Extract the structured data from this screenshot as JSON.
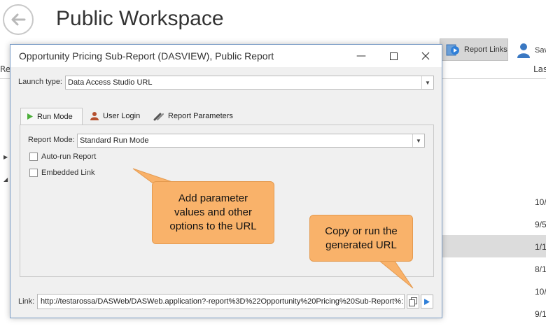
{
  "workspace": {
    "title": "Public Workspace",
    "toolbar": {
      "report_links_label": "Report Links",
      "save_label": "Sav"
    },
    "grid_header": {
      "left": "Re",
      "right": "Las"
    },
    "row_dates": [
      "10/",
      "9/5",
      "1/1",
      "8/1",
      "10/",
      "9/1"
    ]
  },
  "dialog": {
    "title": "Opportunity Pricing Sub-Report (DASVIEW), Public Report",
    "launch_type": {
      "label": "Launch type:",
      "value": "Data Access Studio URL"
    },
    "tabs": [
      {
        "label": "Run Mode",
        "icon": "play-icon",
        "active": true
      },
      {
        "label": "User Login",
        "icon": "user-icon",
        "active": false
      },
      {
        "label": "Report Parameters",
        "icon": "wrench-icon",
        "active": false
      }
    ],
    "report_mode": {
      "label": "Report Mode:",
      "value": "Standard Run Mode"
    },
    "checkboxes": [
      {
        "label": "Auto-run Report",
        "checked": false
      },
      {
        "label": "Embedded Link",
        "checked": false
      }
    ],
    "link": {
      "label": "Link:",
      "value": "http://testarossa/DASWeb/DASWeb.application?-report%3D%22Opportunity%20Pricing%20Sub-Report%:"
    }
  },
  "callouts": {
    "params": [
      "Add parameter",
      "values and other",
      "options to the URL"
    ],
    "copy": [
      "Copy or run the",
      "generated URL"
    ]
  },
  "colors": {
    "callout_fill": "#f9b26a",
    "accent_blue": "#2f7fd8",
    "play_green": "#4caf3a"
  }
}
